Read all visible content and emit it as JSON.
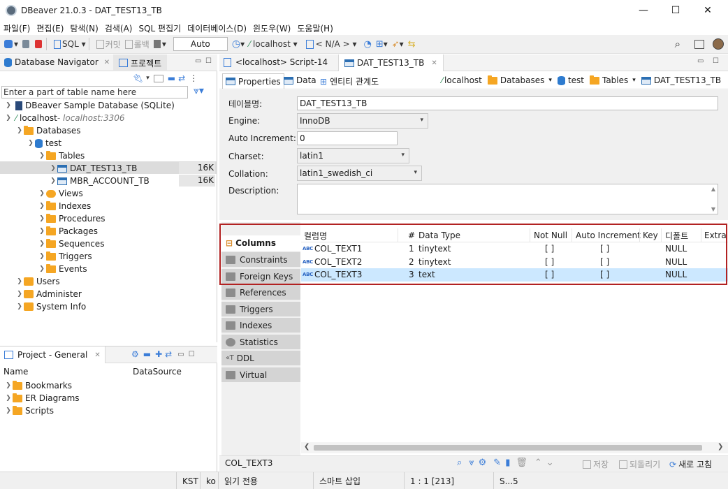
{
  "window": {
    "title": "DBeaver 21.0.3 - DAT_TEST13_TB",
    "minimize": "—",
    "maximize": "☐",
    "close": "✕"
  },
  "menu": [
    "파일(F)",
    "편집(E)",
    "탐색(N)",
    "검색(A)",
    "SQL 편집기",
    "데이터베이스(D)",
    "윈도우(W)",
    "도움말(H)"
  ],
  "toolbar": {
    "sql": "SQL",
    "commit": "커밋",
    "rollback": "롤백",
    "transaction_mode": "Auto",
    "connection": "localhost",
    "schema": "< N/A >"
  },
  "navigator": {
    "tab": "Database Navigator",
    "tab2": "프로젝트",
    "filter_placeholder": "Enter a part of table name here",
    "sample_db": "DBeaver Sample Database (SQLite)",
    "connection": "localhost",
    "connection_host": " - localhost:3306",
    "databases": "Databases",
    "schema": "test",
    "tables": "Tables",
    "table1": "DAT_TEST13_TB",
    "table1_size": "16K",
    "table2": "MBR_ACCOUNT_TB",
    "table2_size": "16K",
    "views": "Views",
    "indexes": "Indexes",
    "procedures": "Procedures",
    "packages": "Packages",
    "sequences": "Sequences",
    "triggers": "Triggers",
    "events": "Events",
    "users": "Users",
    "administer": "Administer",
    "system_info": "System Info"
  },
  "project": {
    "tab": "Project - General",
    "col_name": "Name",
    "col_datasource": "DataSource",
    "items": [
      "Bookmarks",
      "ER Diagrams",
      "Scripts"
    ]
  },
  "editor_tabs": [
    "<localhost> Script-14",
    "DAT_TEST13_TB"
  ],
  "sub_tabs": [
    "Properties",
    "Data",
    "엔티티 관계도"
  ],
  "breadcrumb": [
    "localhost",
    "Databases",
    "test",
    "Tables",
    "DAT_TEST13_TB"
  ],
  "props": {
    "table_name_label": "테이블명:",
    "table_name": "DAT_TEST13_TB",
    "engine_label": "Engine:",
    "engine": "InnoDB",
    "auto_inc_label": "Auto Increment:",
    "auto_inc": "0",
    "charset_label": "Charset:",
    "charset": "latin1",
    "collation_label": "Collation:",
    "collation": "latin1_swedish_ci",
    "description_label": "Description:"
  },
  "side_tabs": [
    "Columns",
    "Constraints",
    "Foreign Keys",
    "References",
    "Triggers",
    "Indexes",
    "Statistics",
    "DDL",
    "Virtual"
  ],
  "grid": {
    "headers": [
      "컬럼명",
      "#",
      "Data Type",
      "Not Null",
      "Auto Increment",
      "Key",
      "디폴트",
      "Extra"
    ],
    "rows": [
      {
        "name": "COL_TEXT1",
        "num": "1",
        "type": "tinytext",
        "notnull": "[ ]",
        "autoinc": "[ ]",
        "default": "NULL"
      },
      {
        "name": "COL_TEXT2",
        "num": "2",
        "type": "tinytext",
        "notnull": "[ ]",
        "autoinc": "[ ]",
        "default": "NULL"
      },
      {
        "name": "COL_TEXT3",
        "num": "3",
        "type": "text",
        "notnull": "[ ]",
        "autoinc": "[ ]",
        "default": "NULL"
      }
    ]
  },
  "bottom": {
    "selected": "COL_TEXT3",
    "save": "저장",
    "revert": "되돌리기",
    "refresh": "새로 고침"
  },
  "status": {
    "tz": "KST",
    "lang": "ko",
    "mode": "읽기 전용",
    "insert": "스마트 삽입",
    "pos": "1 : 1 [213]",
    "extra": "S...5"
  },
  "colors": {
    "accent": "#2a64c2",
    "highlight_border": "#b22222",
    "selected_row": "#cce8ff"
  }
}
